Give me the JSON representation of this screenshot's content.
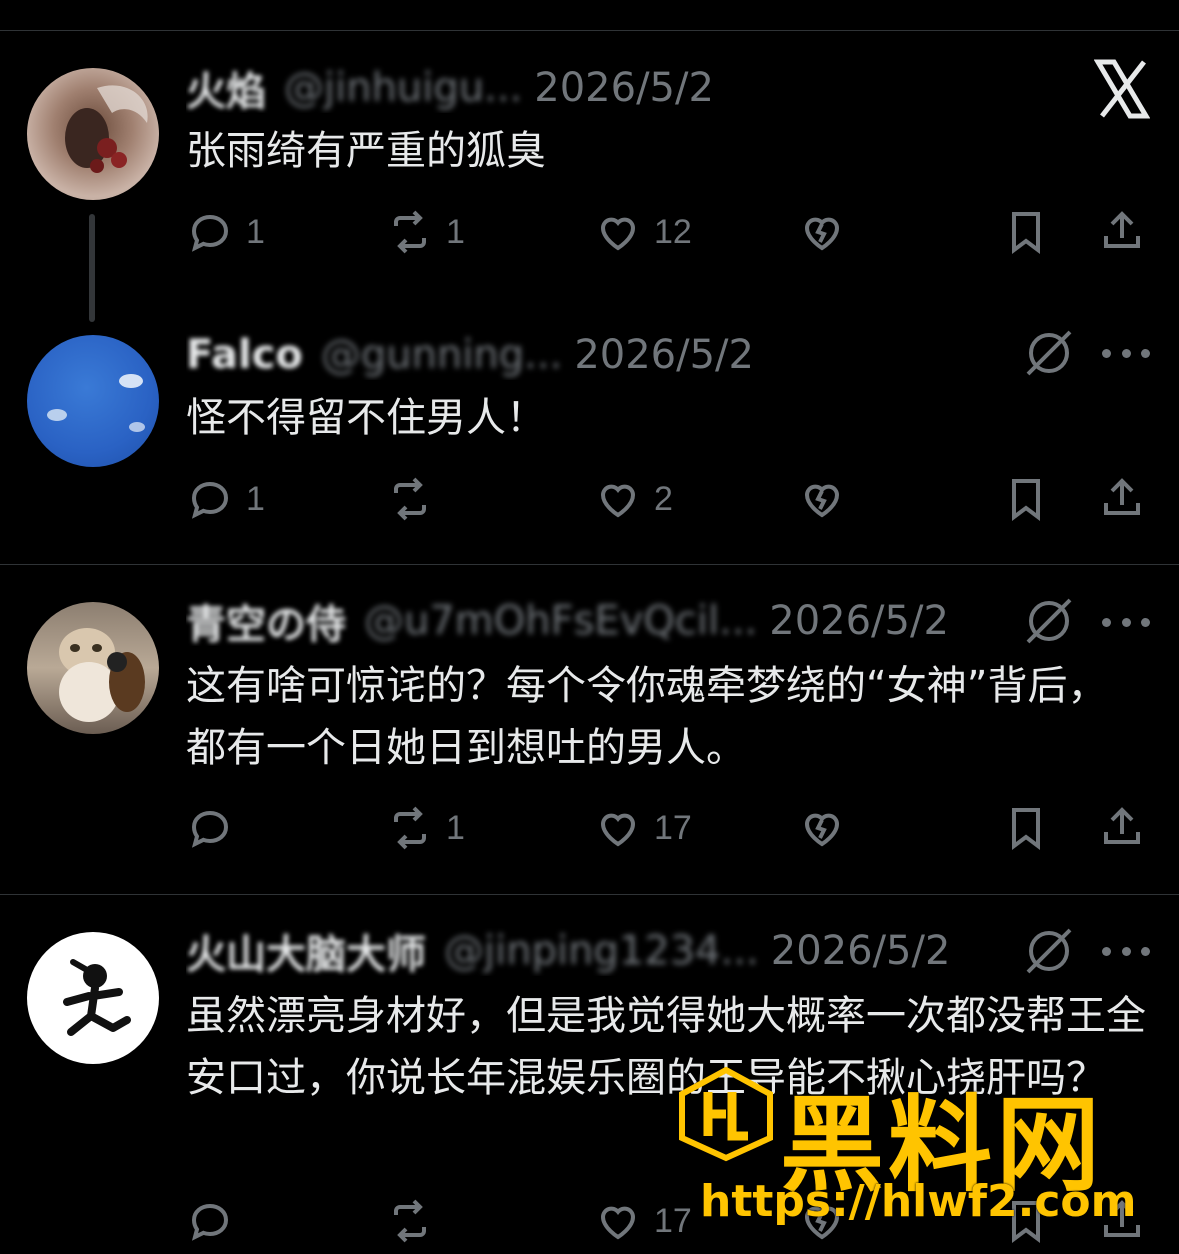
{
  "posts": [
    {
      "name": "火焰",
      "handle": "@jinhuigu...",
      "date": "2026/5/2",
      "text": "张雨绮有严重的狐臭",
      "reply_count": "1",
      "repost_count": "1",
      "like_count": "12"
    },
    {
      "name": "Falco",
      "handle": "@gunning...",
      "date": "2026/5/2",
      "text": "怪不得留不住男人！",
      "reply_count": "1",
      "repost_count": "",
      "like_count": "2"
    },
    {
      "name": "青空の侍",
      "handle": "@u7mOhFsEvQcil...",
      "date": "2026/5/2",
      "text": "这有啥可惊诧的？每个令你魂牵梦绕的“女神”背后，都有一个日她日到想吐的男人。",
      "reply_count": "",
      "repost_count": "1",
      "like_count": "17"
    },
    {
      "name": "火山大脑大师",
      "handle": "@jinping1234...",
      "date": "2026/5/2",
      "text": "虽然漂亮身材好，但是我觉得她大概率一次都没帮王全安口过，你说长年混娱乐圈的王导能不揪心挠肝吗？",
      "reply_count": "",
      "repost_count": "",
      "like_count": "17"
    }
  ],
  "icons": {
    "x_logo": "x-logo",
    "grok": "grok-icon",
    "more": "more-icon",
    "reply": "reply-icon",
    "repost": "repost-icon",
    "like": "heart-icon",
    "dislike": "broken-heart-icon",
    "bookmark": "bookmark-icon",
    "share": "share-icon"
  },
  "watermark": {
    "title": "黑料网",
    "url": "https://hlwf2.com"
  },
  "colors": {
    "background": "#000000",
    "text": "#e7e9ea",
    "muted": "#71767b",
    "divider": "#2f3336",
    "watermark": "#ffc400"
  }
}
